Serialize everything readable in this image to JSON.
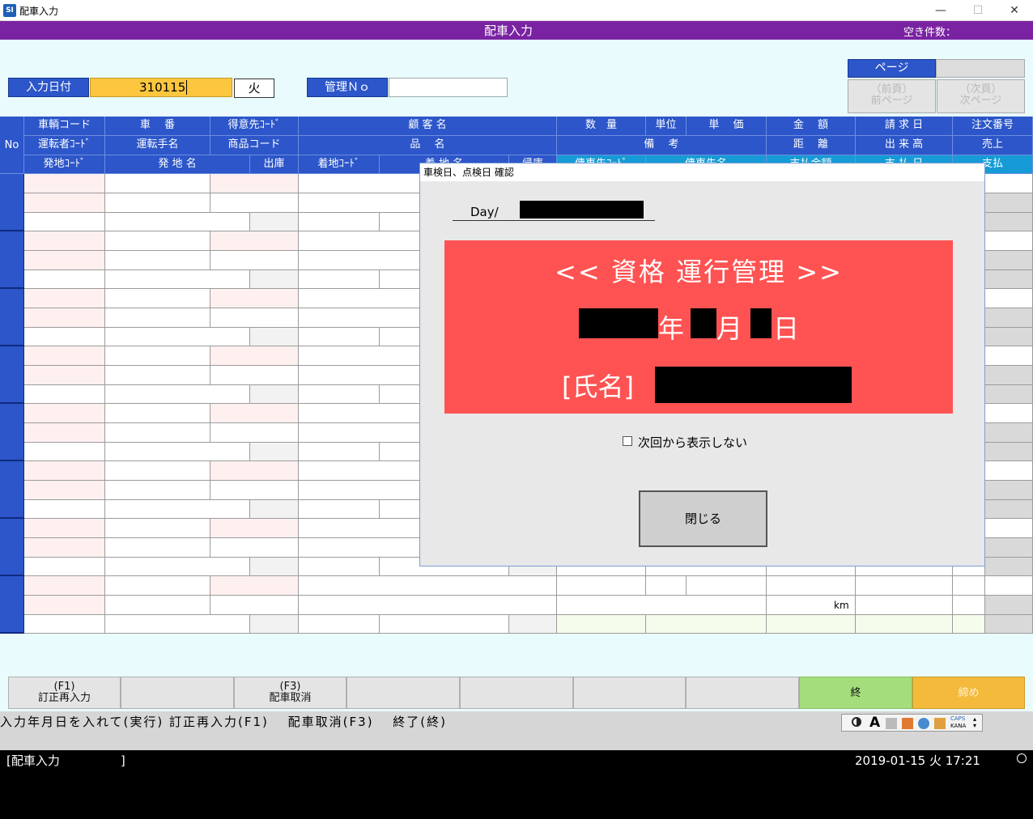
{
  "window": {
    "title": "配車入力",
    "app_icon": "SI",
    "minimize": "—",
    "maximize": "☐",
    "close": "✕"
  },
  "header": {
    "title": "配車入力",
    "vacancy_label": "空き件数："
  },
  "form": {
    "date_label": "入力日付",
    "date_value": "310115",
    "weekday": "火",
    "mgmt_label": "管理Ｎｏ",
    "mgmt_value": "",
    "page_label": "ページ",
    "page_value": "",
    "prev_line1": "（前頁）",
    "prev_line2": "前ページ",
    "next_line1": "（次頁）",
    "next_line2": "次ページ"
  },
  "table": {
    "no_label": "No",
    "row1": [
      "車輌コード",
      "車　 番",
      "得意先ｺｰﾄﾞ",
      "顧 客 名",
      "数　量",
      "単位",
      "単　 価",
      "金　 額",
      "請 求 日",
      "注文番号"
    ],
    "row2": [
      "運転者ｺｰﾄﾞ",
      "運転手名",
      "商品コード",
      "品　 名",
      "備　 考",
      "距　 離",
      "出 来 高",
      "売上"
    ],
    "row3": [
      "発地ｺｰﾄﾞ",
      "発 地 名",
      "出庫",
      "着地ｺｰﾄﾞ",
      "着 地 名",
      "帰庫",
      "傭車先ｺｰﾄﾞ",
      "傭車先名",
      "支払金額",
      "支 払 日",
      "支払"
    ],
    "km_unit": "km"
  },
  "dialog": {
    "title": "車検日、点検日 確認",
    "day_label": "Day/",
    "heading": "<< 資格 運行管理 >>",
    "year_char": "年",
    "month_char": "月",
    "day_char": "日",
    "name_label": "[氏名]",
    "checkbox_label": "次回から表示しない",
    "close_button": "閉じる"
  },
  "fkeys": {
    "f1_line1": "(F1)",
    "f1_line2": "訂正再入力",
    "f3_line1": "(F3)",
    "f3_line2": "配車取消",
    "end": "終",
    "close": "締め"
  },
  "status": {
    "help": "入力年月日を入れて(実行) 訂正再入力(F1)　 配車取消(F3)　 終了(終)",
    "screen": "[配車入力　　　　　]",
    "datetime": "2019-01-15 火 17:21",
    "ime_caps": "CAPS",
    "ime_kana": "KANA",
    "ime_mode": "A"
  },
  "colors": {
    "purple": "#7a23a2",
    "blue_header": "#2c56c9",
    "dialog_red": "#fe5352",
    "end_key": "#a4dd7b",
    "close_key": "#f3ba3c",
    "date_field": "#fcc63e"
  }
}
